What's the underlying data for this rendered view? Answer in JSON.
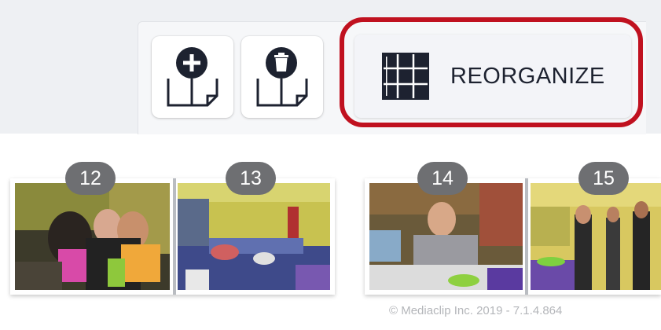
{
  "toolbar": {
    "add_page_icon": "add-page-icon",
    "delete_page_icon": "delete-page-icon",
    "reorganize": {
      "icon": "grid-icon",
      "label": "REORGANIZE"
    },
    "highlight_color": "#c0111f"
  },
  "pages": [
    {
      "number": "12"
    },
    {
      "number": "13"
    },
    {
      "number": "14"
    },
    {
      "number": "15"
    }
  ],
  "footer": {
    "copyright": "© Mediaclip Inc. 2019 - 7.1.4.864"
  },
  "colors": {
    "badge": "#6e6f72",
    "toolbar_bg": "#eef0f3",
    "text": "#1d2230"
  }
}
